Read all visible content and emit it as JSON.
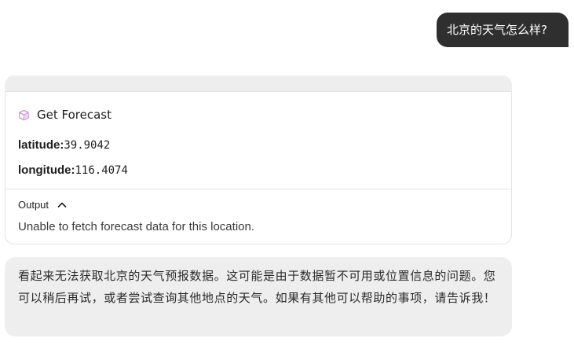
{
  "user_message": {
    "text": "北京的天气怎么样?"
  },
  "tool_call": {
    "icon": "cube-icon",
    "name": "Get Forecast",
    "params": [
      {
        "key": "latitude:",
        "value": "39.9042"
      },
      {
        "key": "longitude:",
        "value": "116.4074"
      }
    ],
    "output": {
      "label": "Output",
      "expanded": true,
      "text": "Unable to fetch forecast data for this location."
    }
  },
  "assistant_message": {
    "text": "看起来无法获取北京的天气预报数据。这可能是由于数据暂不可用或位置信息的问题。您可以稍后再试，或者尝试查询其他地点的天气。如果有其他可以帮助的事项，请告诉我！"
  },
  "colors": {
    "user_bubble_bg": "#2f2f2f",
    "assistant_bubble_bg": "#eeeeee",
    "icon_accent": "#c68bd6"
  }
}
